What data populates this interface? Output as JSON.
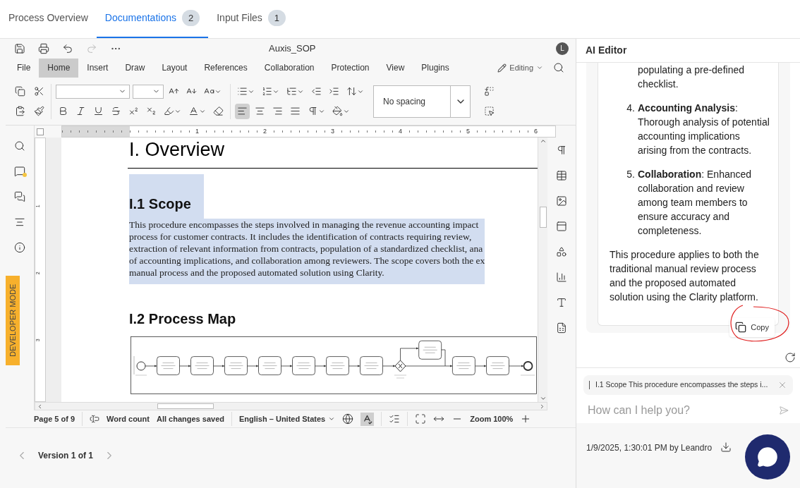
{
  "tabs": [
    {
      "label": "Process Overview",
      "selected": false
    },
    {
      "label": "Documentations",
      "count": "2",
      "selected": true
    },
    {
      "label": "Input Files",
      "count": "1",
      "selected": false
    }
  ],
  "editor": {
    "title": "Auxis_SOP",
    "avatar": "L",
    "menu": [
      {
        "label": "File",
        "selected": false
      },
      {
        "label": "Home",
        "selected": true
      },
      {
        "label": "Insert",
        "selected": false
      },
      {
        "label": "Draw",
        "selected": false
      },
      {
        "label": "Layout",
        "selected": false
      },
      {
        "label": "References",
        "selected": false
      },
      {
        "label": "Collaboration",
        "selected": false
      },
      {
        "label": "Protection",
        "selected": false
      },
      {
        "label": "View",
        "selected": false
      },
      {
        "label": "Plugins",
        "selected": false
      }
    ],
    "mode": "Editing",
    "paragraph_style": "No spacing",
    "align_buttons": [
      {
        "kind": "left",
        "selected": true
      },
      {
        "kind": "center",
        "selected": false
      },
      {
        "kind": "right",
        "selected": false
      },
      {
        "kind": "justify",
        "selected": false
      }
    ],
    "ruler": {
      "horizontal": [
        "1",
        "2",
        "3",
        "4",
        "5",
        "6"
      ],
      "vertical": [
        "1",
        "2",
        "3"
      ]
    },
    "side_badge": "DEVELOPER MODE",
    "document": {
      "heading": "I. Overview",
      "scope": {
        "title": "I.1 Scope",
        "selected": true,
        "lines": [
          "This procedure encompasses the steps involved in managing the revenue accounting impact",
          "process for customer contracts. It includes the identification of contracts requiring review,",
          "extraction of relevant information from contracts, population of a standardized checklist, ana",
          "of accounting implications, and collaboration among reviewers. The scope covers both the ex",
          "manual process and the proposed automated solution using Clarity."
        ]
      },
      "map_title": "I.2 Process Map"
    },
    "status": {
      "page": "Page 5 of 9",
      "word_count": "Word count",
      "saved": "All changes saved",
      "language": "English – United States",
      "spellcheck_on": true,
      "zoom": "Zoom 100%"
    }
  },
  "version": "Version 1 of 1",
  "ai_editor": {
    "title": "AI Editor",
    "items": [
      {
        "text": "populating a pre-defined checklist."
      },
      {
        "number": "4.",
        "text": "**Accounting Analysis**: Thorough analysis of potential accounting implications arising from the contracts."
      },
      {
        "number": "5.",
        "text": "**Collaboration**: Enhanced collaboration and review among team members to ensure accuracy and completeness."
      }
    ],
    "paragraph": "This procedure applies to both the traditional manual review process and the proposed automated solution using the Clarity platform.",
    "copy": "Copy",
    "context": "I.1 Scope This procedure encompasses the steps i...",
    "placeholder": "How can I help you?",
    "saved_by": "1/9/2025, 1:30:01 PM by Leandro"
  }
}
